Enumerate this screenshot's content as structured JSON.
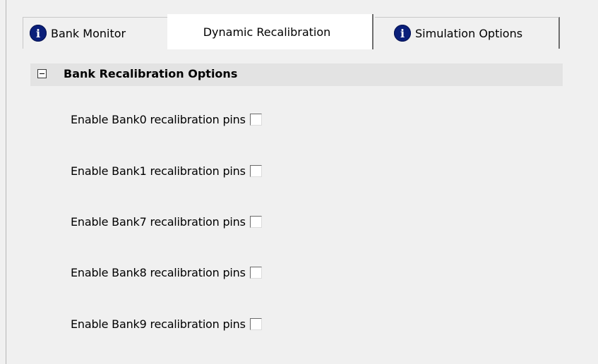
{
  "tabs": [
    {
      "label": "Bank Monitor",
      "icon": "info-icon"
    },
    {
      "label": "Dynamic Recalibration"
    },
    {
      "label": "Simulation Options",
      "icon": "info-icon"
    }
  ],
  "active_tab": "Dynamic Recalibration",
  "icons": {
    "info_glyph": "i"
  },
  "section": {
    "title": "Bank Recalibration Options",
    "expanded": true,
    "options": [
      {
        "label": "Enable Bank0 recalibration pins",
        "checked": false
      },
      {
        "label": "Enable Bank1 recalibration pins",
        "checked": false
      },
      {
        "label": "Enable Bank7 recalibration pins",
        "checked": false
      },
      {
        "label": "Enable Bank8 recalibration pins",
        "checked": false
      },
      {
        "label": "Enable Bank9 recalibration pins",
        "checked": false
      }
    ]
  },
  "colors": {
    "info_icon": "#0a1f7a",
    "active_tab_bg": "#ffffff",
    "section_header_bg": "#e3e3e3",
    "panel_bg": "#f0f0f0"
  }
}
